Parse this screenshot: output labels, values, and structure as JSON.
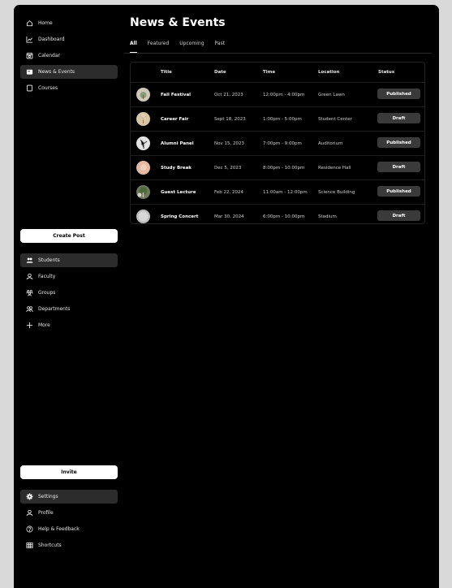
{
  "sidebar": {
    "nav": [
      {
        "label": "Home",
        "icon": "home-icon"
      },
      {
        "label": "Dashboard",
        "icon": "chart-icon"
      },
      {
        "label": "Calendar",
        "icon": "calendar-icon"
      },
      {
        "label": "News & Events",
        "icon": "news-icon",
        "active": true
      },
      {
        "label": "Courses",
        "icon": "book-icon"
      }
    ],
    "create_post": "Create Post",
    "people": [
      {
        "label": "Students",
        "icon": "students-icon",
        "active": true
      },
      {
        "label": "Faculty",
        "icon": "person-icon"
      },
      {
        "label": "Groups",
        "icon": "groups-icon"
      },
      {
        "label": "Departments",
        "icon": "departments-icon"
      },
      {
        "label": "More",
        "icon": "plus-icon"
      }
    ],
    "invite": "Invite",
    "footer": [
      {
        "label": "Settings",
        "icon": "gear-icon",
        "active": true
      },
      {
        "label": "Profile",
        "icon": "person-icon"
      },
      {
        "label": "Help & Feedback",
        "icon": "help-icon"
      },
      {
        "label": "Shortcuts",
        "icon": "grid-icon"
      }
    ]
  },
  "main": {
    "title": "News & Events",
    "tabs": [
      "All",
      "Featured",
      "Upcoming",
      "Past"
    ],
    "active_tab": "All",
    "columns": [
      "Title",
      "Date",
      "Time",
      "Location",
      "Status"
    ],
    "rows": [
      {
        "title": "Fall Festival",
        "date": "Oct 21, 2023",
        "time": "12:00pm - 4:00pm",
        "location": "Green Lawn",
        "status": "Published"
      },
      {
        "title": "Career Fair",
        "date": "Sept 18, 2023",
        "time": "1:00pm - 5:00pm",
        "location": "Student Center",
        "status": "Draft"
      },
      {
        "title": "Alumni Panel",
        "date": "Nov 15, 2023",
        "time": "7:00pm - 9:00pm",
        "location": "Auditorium",
        "status": "Published"
      },
      {
        "title": "Study Break",
        "date": "Dec 5, 2023",
        "time": "8:00pm - 10:00pm",
        "location": "Residence Hall",
        "status": "Draft"
      },
      {
        "title": "Guest Lecture",
        "date": "Feb 22, 2024",
        "time": "11:00am - 12:00pm",
        "location": "Science Building",
        "status": "Published"
      },
      {
        "title": "Spring Concert",
        "date": "Mar 30, 2024",
        "time": "6:00pm - 10:00pm",
        "location": "Stadium",
        "status": "Draft"
      }
    ]
  },
  "colors": {
    "background": "#000000",
    "page": "#d9d9d9",
    "active_item": "#2c2c2c",
    "status_badge": "#3a3a3a"
  }
}
